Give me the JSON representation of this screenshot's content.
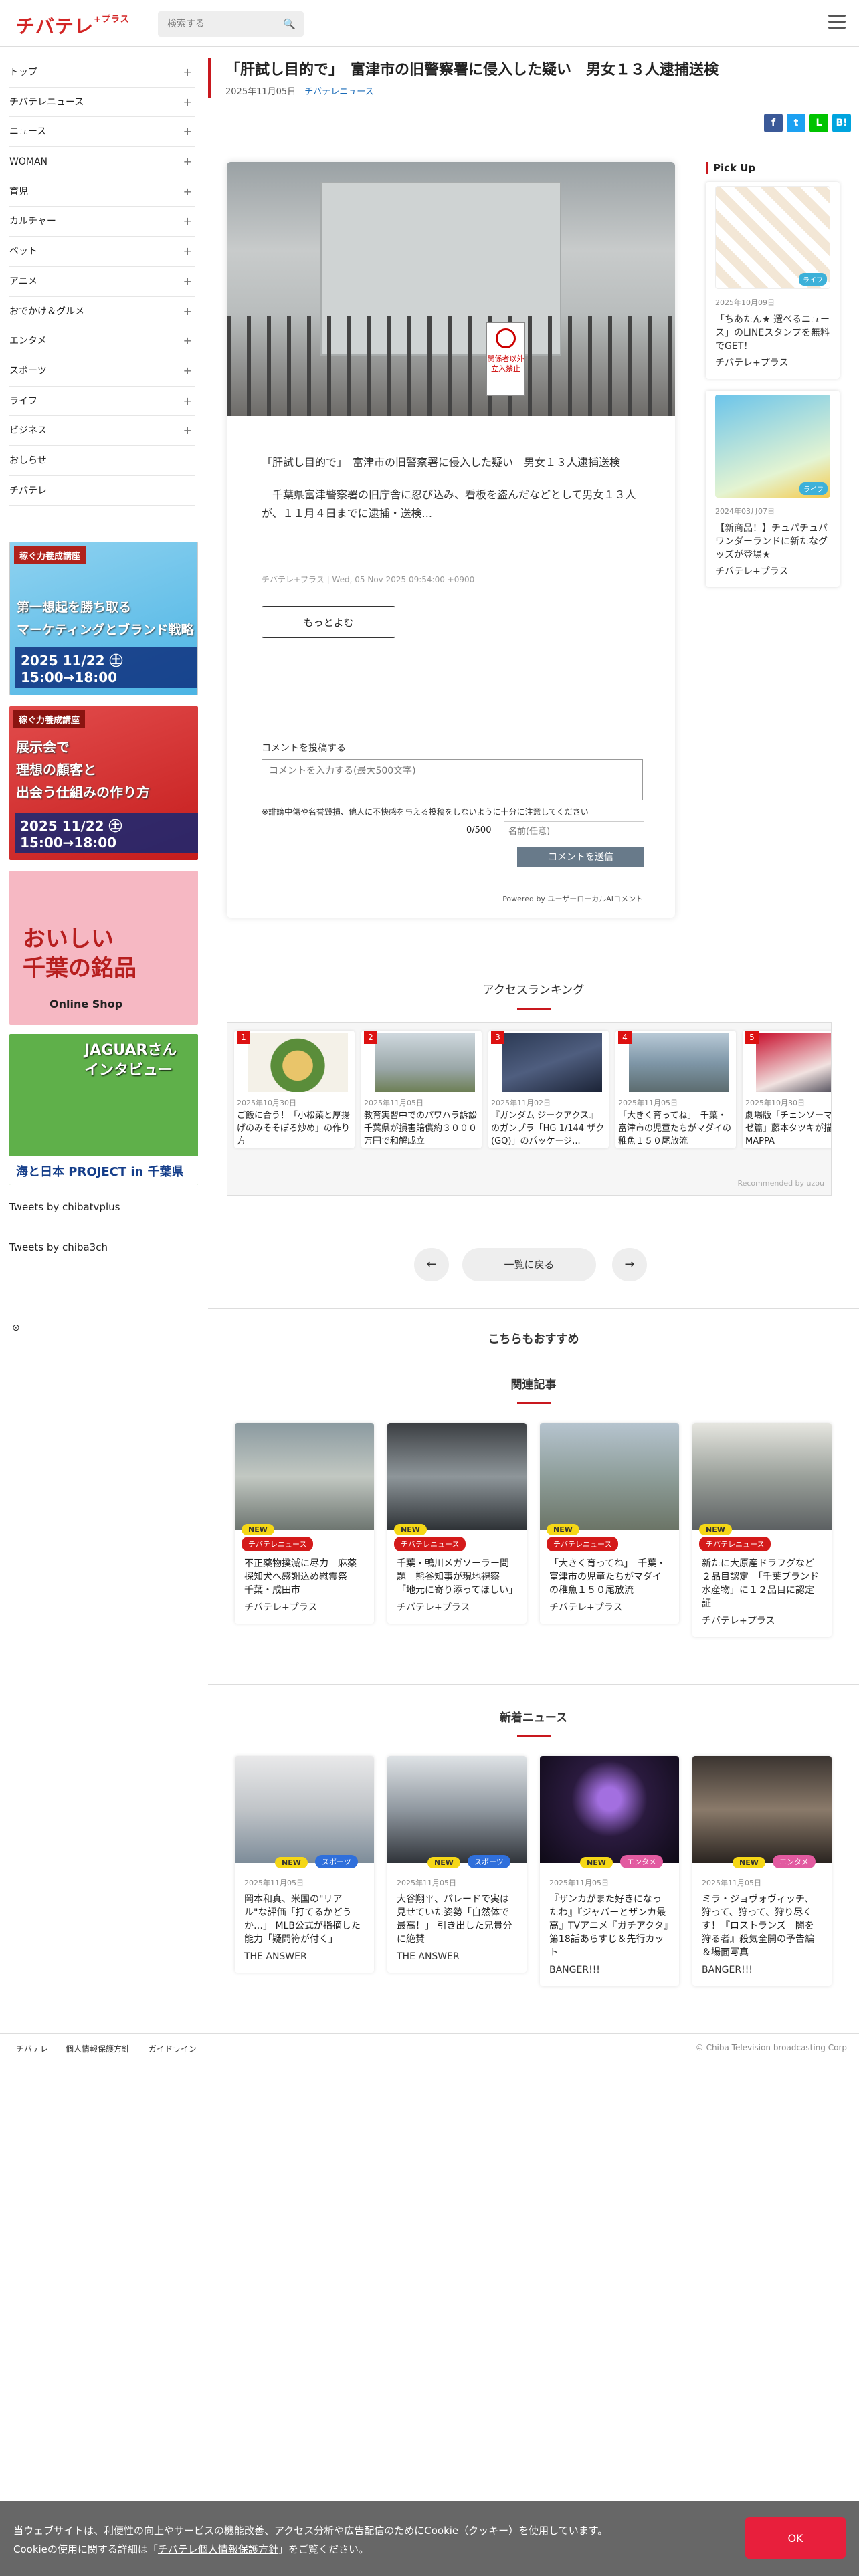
{
  "header": {
    "logo": "チバテレ",
    "logo_small": "+プラス",
    "search_placeholder": "検索する"
  },
  "sidebar": {
    "items": [
      {
        "label": "トップ"
      },
      {
        "label": "チバテレニュース"
      },
      {
        "label": "ニュース"
      },
      {
        "label": "WOMAN"
      },
      {
        "label": "育児"
      },
      {
        "label": "カルチャー"
      },
      {
        "label": "ペット"
      },
      {
        "label": "アニメ"
      },
      {
        "label": "おでかけ＆グルメ"
      },
      {
        "label": "エンタメ"
      },
      {
        "label": "スポーツ"
      },
      {
        "label": "ライフ"
      },
      {
        "label": "ビジネス"
      },
      {
        "label": "おしらせ"
      },
      {
        "label": "チバテレ"
      }
    ],
    "banners": [
      {
        "tag": "稼ぐ力養成講座",
        "text": "第一想起を勝ち取る\nマーケティングとブランド戦略",
        "date": "2025 11/22 ㊏ 15:00→18:00"
      },
      {
        "tag": "稼ぐ力養成講座",
        "text": "展示会で\n理想の顧客と\n出会う仕組みの作り方",
        "date": "2025 11/22 ㊏ 15:00→18:00"
      },
      {
        "title": "おいしい\n千葉の銘品",
        "sub": "Online Shop"
      },
      {
        "title": "JAGUARさん\nインタビュー",
        "sub": "海と日本 PROJECT in 千葉県"
      }
    ],
    "tweets1": "Tweets by chibatvplus",
    "tweets2": "Tweets by chiba3ch"
  },
  "article": {
    "title": "「肝試し目的で」　富津市の旧警察署に侵入した疑い　男女１３人逮捕送検",
    "date": "2025年11月05日",
    "source": "チバテレニュース",
    "sign_text": "関係者以外立入禁止",
    "lead": "「肝試し目的で」　富津市の旧警察署に侵入した疑い　男女１３人逮捕送検",
    "body": "　千葉県富津警察署の旧庁舎に忍び込み、看板を盗んだなどとして男女１３人が、１１月４日までに逮捕・送検...",
    "meta": "チバテレ+プラス | Wed, 05 Nov 2025 09:54:00 +0900",
    "more_label": "もっとよむ"
  },
  "comment": {
    "heading": "コメントを投稿する",
    "placeholder": "コメントを入力する(最大500文字)",
    "warning": "※誹謗中傷や名誉毀損、他人に不快感を与える投稿をしないように十分に注意してください",
    "count": "0/500",
    "name_placeholder": "名前(任意)",
    "submit": "コメントを送信",
    "powered": "Powered by ユーザーローカルAIコメント"
  },
  "pickup": {
    "heading": "Pick Up",
    "items": [
      {
        "date": "2025年10月09日",
        "title": "「ちあたん★ 選べるニュース」のLINEスタンプを無料でGET！",
        "source": "チバテレ+プラス",
        "badge": "ライフ"
      },
      {
        "date": "2024年03月07日",
        "title": "【新商品！】チュパチュパワンダーランドに新たなグッズが登場★",
        "source": "チバテレ+プラス",
        "badge": "ライフ"
      }
    ]
  },
  "ranking": {
    "heading": "アクセスランキング",
    "items": [
      {
        "num": "1",
        "date": "2025年10月30日",
        "title": "ご飯に合う！「小松菜と厚揚げのみそそぼろ炒め」の作り方"
      },
      {
        "num": "2",
        "date": "2025年11月05日",
        "title": "教育実習中でのパワハラ訴訟　千葉県が損害賠償約３０００万円で和解成立"
      },
      {
        "num": "3",
        "date": "2025年11月02日",
        "title": "『ガンダム ジークアクス』のガンプラ「HG 1/144 ザク(GQ)」のパッケージ..."
      },
      {
        "num": "4",
        "date": "2025年11月05日",
        "title": "「大きく育ってね」　千葉・富津市の児童たちがマダイの稚魚１５０尾放流"
      },
      {
        "num": "5",
        "date": "2025年10月30日",
        "title": "劇場版「チェンソーマン レゼ篇」藤本タツキが描く愛とMAPPA"
      }
    ],
    "recommended": "Recommended by uzou"
  },
  "pager": {
    "prev": "←",
    "list": "一覧に戻る",
    "next": "→"
  },
  "recommend_heading": "こちらもおすすめ",
  "related": {
    "heading": "関連記事",
    "items": [
      {
        "badge": "NEW",
        "cat": "チバテレニュース",
        "title": "不正薬物撲滅に尽力　麻薬探知犬へ感謝込め慰霊祭　千葉・成田市",
        "source": "チバテレ+プラス"
      },
      {
        "badge": "NEW",
        "cat": "チバテレニュース",
        "title": "千葉・鴨川メガソーラー問題　熊谷知事が現地視察「地元に寄り添ってほしい」",
        "source": "チバテレ+プラス"
      },
      {
        "badge": "NEW",
        "cat": "チバテレニュース",
        "title": "「大きく育ってね」　千葉・富津市の児童たちがマダイの稚魚１５０尾放流",
        "source": "チバテレ+プラス"
      },
      {
        "badge": "NEW",
        "cat": "チバテレニュース",
        "title": "新たに大原産ドラフグなど２品目認定　「千葉ブランド水産物」に１２品目に認定証",
        "source": "チバテレ+プラス"
      }
    ]
  },
  "latest": {
    "heading": "新着ニュース",
    "items": [
      {
        "badge": "NEW",
        "cat": "スポーツ",
        "date": "2025年11月05日",
        "title": "岡本和真、米国の\"リアル\"な評価「打てるかどうか…」 MLB公式が指摘した能力「疑問符が付く」",
        "source": "THE ANSWER"
      },
      {
        "badge": "NEW",
        "cat": "スポーツ",
        "date": "2025年11月05日",
        "title": "大谷翔平、パレードで実は見せていた姿勢「自然体で最高！」 引き出した兄貴分に絶賛",
        "source": "THE ANSWER"
      },
      {
        "badge": "NEW",
        "cat": "エンタメ",
        "date": "2025年11月05日",
        "title": "『ザンカがまた好きになったわ』『ジャバーとザンカ最高』TVアニメ『ガチアクタ』第18話あらすじ＆先行カット",
        "source": "BANGER!!!"
      },
      {
        "badge": "NEW",
        "cat": "エンタメ",
        "date": "2025年11月05日",
        "title": "ミラ・ジョヴォヴィッチ、狩って、狩って、狩り尽くす！『ロストランズ　闇を狩る者』殺気全開の予告編＆場面写真",
        "source": "BANGER!!!"
      }
    ]
  },
  "footer": {
    "links": [
      "チバテレ",
      "個人情報保護方針",
      "ガイドライン"
    ],
    "copyright": "© Chiba Television broadcasting Corp"
  },
  "cookie": {
    "line1": "当ウェブサイトは、利便性の向上やサービスの機能改善、アクセス分析や広告配信のためにCookie（クッキー）を使用しています。",
    "line2_pre": "Cookieの使用に関する詳細は「",
    "line2_link": "チバテレ個人情報保護方針",
    "line2_post": "」をご覧ください。",
    "ok": "OK"
  },
  "colors": {
    "accent": "#c9181e",
    "facebook": "#3b5998",
    "twitter": "#1da1f2",
    "line": "#00c300",
    "hatena": "#00a4de",
    "sports": "#2f6fdb",
    "entame": "#e25aa0"
  }
}
